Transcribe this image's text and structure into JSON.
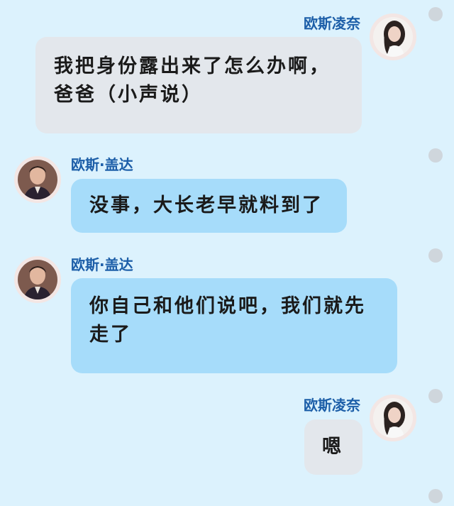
{
  "messages": [
    {
      "sender": "欧斯凌奈",
      "side": "right",
      "avatar_icon": "girl-avatar-icon",
      "lines": [
        "我把身份露出来了怎么办啊，",
        "爸爸（小声说）"
      ]
    },
    {
      "sender": "欧斯·盖达",
      "side": "left",
      "avatar_icon": "man-avatar-icon",
      "lines": [
        "没事，大长老早就料到了"
      ]
    },
    {
      "sender": "欧斯·盖达",
      "side": "left",
      "avatar_icon": "man-avatar-icon",
      "lines": [
        "你自己和他们说吧，我们就先",
        "走了"
      ]
    },
    {
      "sender": "欧斯凌奈",
      "side": "right",
      "avatar_icon": "girl-avatar-icon",
      "lines": [
        "嗯"
      ]
    }
  ],
  "colors": {
    "background": "#dcf2fd",
    "sender_name": "#1c5ea8",
    "bubble_gray": "#e3e7ec",
    "bubble_blue": "#a6dcfa",
    "indicator_dot": "#cfd6dc"
  }
}
